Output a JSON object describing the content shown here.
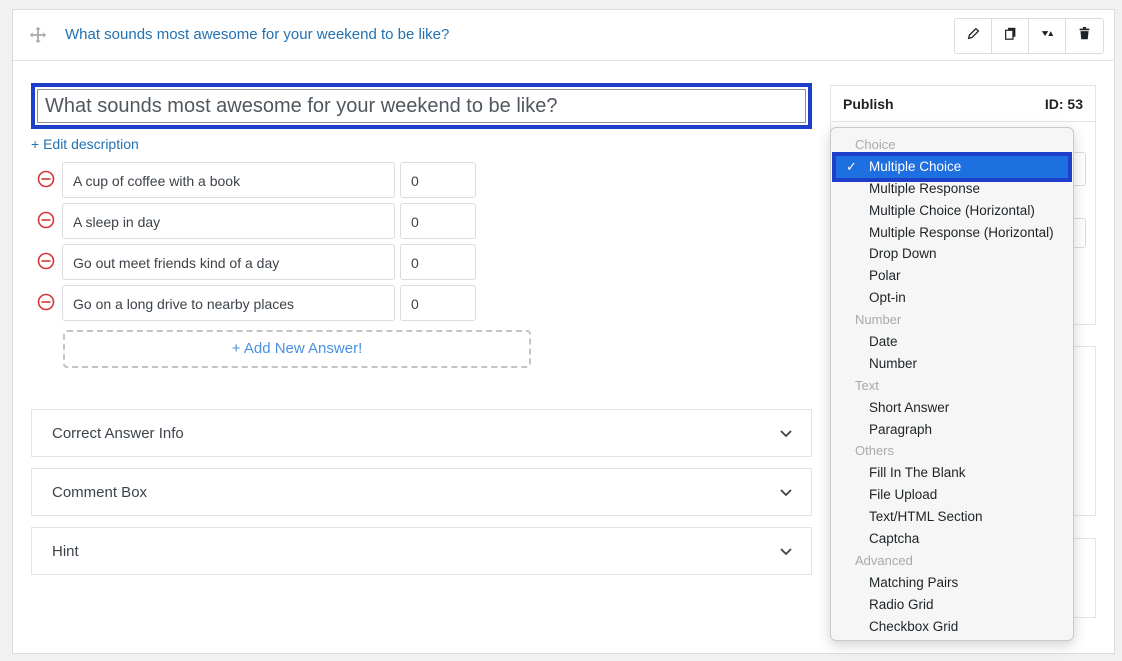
{
  "header": {
    "title": "What sounds most awesome for your weekend to be like?"
  },
  "toolbar": {
    "icons": [
      "pencil-icon",
      "duplicate-icon",
      "collapse-icon",
      "trash-icon"
    ]
  },
  "question": {
    "title": "What sounds most awesome for your weekend to be like?"
  },
  "edit_description_label": "+ Edit description",
  "answers": [
    {
      "text": "A cup of coffee with a book",
      "points": "0"
    },
    {
      "text": "A sleep in day",
      "points": "0"
    },
    {
      "text": "Go out meet friends kind of a day",
      "points": "0"
    },
    {
      "text": "Go on a long drive to nearby places",
      "points": "0"
    }
  ],
  "add_answer_label": "+ Add New Answer!",
  "sections": [
    {
      "label": "Correct Answer Info"
    },
    {
      "label": "Comment Box"
    },
    {
      "label": "Hint"
    }
  ],
  "publish": {
    "title": "Publish",
    "id_label": "ID: 53"
  },
  "dropdown": {
    "checkmark": "✓",
    "groups": [
      {
        "label": "Choice",
        "items": [
          "Multiple Choice",
          "Multiple Response",
          "Multiple Choice (Horizontal)",
          "Multiple Response (Horizontal)",
          "Drop Down",
          "Polar",
          "Opt-in"
        ]
      },
      {
        "label": "Number",
        "items": [
          "Date",
          "Number"
        ]
      },
      {
        "label": "Text",
        "items": [
          "Short Answer",
          "Paragraph"
        ]
      },
      {
        "label": "Others",
        "items": [
          "Fill In The Blank",
          "File Upload",
          "Text/HTML Section",
          "Captcha"
        ]
      },
      {
        "label": "Advanced",
        "items": [
          "Matching Pairs",
          "Radio Grid",
          "Checkbox Grid"
        ]
      }
    ],
    "selected": "Multiple Choice"
  },
  "colors": {
    "accent": "#2271b1",
    "selection": "#1e6fe0",
    "highlight_border": "#1e3fc9",
    "remove": "#d63638"
  }
}
